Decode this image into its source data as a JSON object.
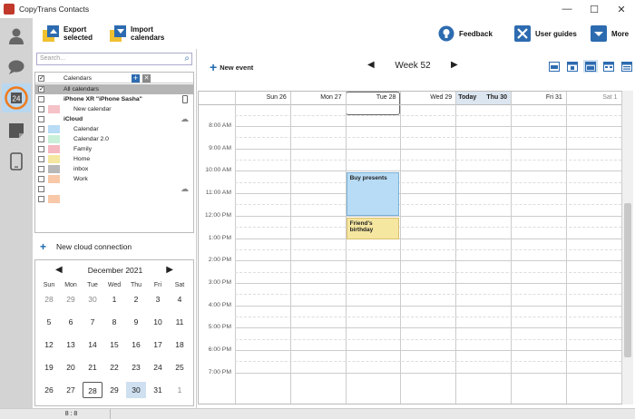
{
  "app": {
    "title": "CopyTrans Contacts"
  },
  "toolbar": {
    "export": [
      "Export",
      "selected"
    ],
    "import": [
      "Import",
      "calendars"
    ],
    "feedback": "Feedback",
    "guides": "User guides",
    "more": "More"
  },
  "leftbar": {
    "calendar_badge": "24"
  },
  "search": {
    "placeholder": "Search..."
  },
  "calendar_list": {
    "header": "Calendars",
    "rows": [
      {
        "label": "All calendars",
        "checked": true,
        "swatch": "",
        "bold": false,
        "selected": true
      },
      {
        "label": "iPhone XR \"iPhone Sasha\"",
        "checked": false,
        "swatch": "",
        "bold": true,
        "device": true
      },
      {
        "label": "New calendar",
        "checked": false,
        "swatch": "#f5c2c7",
        "bold": false
      },
      {
        "label": "iCloud",
        "checked": false,
        "swatch": "",
        "bold": true,
        "cloud": true
      },
      {
        "label": "Calendar",
        "checked": false,
        "swatch": "#b8dcf5",
        "bold": false
      },
      {
        "label": "Calendar 2.0",
        "checked": false,
        "swatch": "#c8f0d8",
        "bold": false
      },
      {
        "label": "Family",
        "checked": false,
        "swatch": "#f5b8c0",
        "bold": false
      },
      {
        "label": "Home",
        "checked": false,
        "swatch": "#f5e6a0",
        "bold": false
      },
      {
        "label": "inbox",
        "checked": false,
        "swatch": "#b8b8b8",
        "bold": false
      },
      {
        "label": "Work",
        "checked": false,
        "swatch": "#f8c8a8",
        "bold": false
      },
      {
        "label": "",
        "checked": false,
        "swatch": "",
        "bold": false,
        "cloud": true
      },
      {
        "label": "",
        "checked": false,
        "swatch": "#f8c8a8",
        "bold": false
      }
    ]
  },
  "new_cloud": "New cloud connection",
  "minical": {
    "month": "December 2021",
    "dow": [
      "Sun",
      "Mon",
      "Tue",
      "Wed",
      "Thu",
      "Fri",
      "Sat"
    ],
    "weeks": [
      [
        "28",
        "29",
        "30",
        "1",
        "2",
        "3",
        "4"
      ],
      [
        "5",
        "6",
        "7",
        "8",
        "9",
        "10",
        "11"
      ],
      [
        "12",
        "13",
        "14",
        "15",
        "16",
        "17",
        "18"
      ],
      [
        "19",
        "20",
        "21",
        "22",
        "23",
        "24",
        "25"
      ],
      [
        "26",
        "27",
        "28",
        "29",
        "30",
        "31",
        "1"
      ]
    ]
  },
  "calendar": {
    "new_event": "New event",
    "week": "Week 52",
    "days": [
      "Sun 26",
      "Mon 27",
      "Tue 28",
      "Wed 29",
      "Today",
      "Thu 30",
      "Fri 31",
      "Sat 1"
    ],
    "times": [
      "8:00 AM",
      "9:00 AM",
      "10:00 AM",
      "11:00 AM",
      "12:00 PM",
      "1:00 PM",
      "2:00 PM",
      "3:00 PM",
      "4:00 PM",
      "5:00 PM",
      "6:00 PM",
      "7:00 PM"
    ],
    "events": [
      {
        "title": "Buy presents",
        "color": "#b8dcf5",
        "border": "#7ab0d8"
      },
      {
        "title": "Friend's birthday",
        "color": "#f5e6a0",
        "border": "#d8c070"
      }
    ]
  },
  "status": {
    "text": "8 : 8"
  }
}
